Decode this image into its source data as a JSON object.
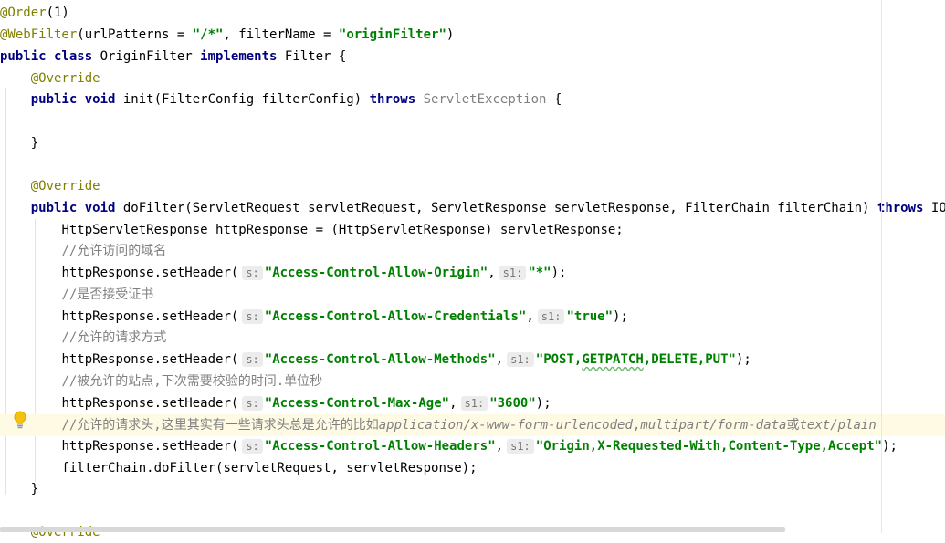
{
  "code": {
    "l0_annot": "@Order",
    "l0_rest": "(1)",
    "l1_annot": "@WebFilter",
    "l1_a": "(urlPatterns = ",
    "l1_s1": "\"/*\"",
    "l1_b": ", filterName = ",
    "l1_s2": "\"originFilter\"",
    "l1_c": ")",
    "l2_kw": "public class",
    "l2_a": " OriginFilter ",
    "l2_kw2": "implements",
    "l2_b": " Filter {",
    "l3_annot": "@Override",
    "l4_kw": "public void",
    "l4_a": " init(FilterConfig filterConfig) ",
    "l4_kw2": "throws",
    "l4_gray": " ServletException",
    "l4_b": " {",
    "l6": "}",
    "l8_annot": "@Override",
    "l9_kw": "public void",
    "l9_a": " doFilter(ServletRequest servletRequest, ServletResponse servletResponse, FilterChain filterChain) ",
    "l9_kw2": "throws",
    "l9_b": " IOException",
    "l10": "HttpServletResponse httpResponse = (HttpServletResponse) servletResponse;",
    "l11": "//允许访问的域名",
    "l12_a": "httpResponse.setHeader(",
    "l12_s1": "\"Access-Control-Allow-Origin\"",
    "l12_b": ",",
    "l12_s2": "\"*\"",
    "l12_c": ");",
    "l13": "//是否接受证书",
    "l14_a": "httpResponse.setHeader(",
    "l14_s1": "\"Access-Control-Allow-Credentials\"",
    "l14_b": ",",
    "l14_s2": "\"true\"",
    "l14_c": ");",
    "l15": "//允许的请求方式",
    "l16_a": "httpResponse.setHeader(",
    "l16_s1": "\"Access-Control-Allow-Methods\"",
    "l16_b": ",",
    "l16_s2a": "\"POST,",
    "l16_s2b": "GETPATCH",
    "l16_s2c": ",DELETE,PUT\"",
    "l16_c": ");",
    "l17": "//被允许的站点,下次需要校验的时间.单位秒",
    "l18_a": "httpResponse.setHeader(",
    "l18_s1": "\"Access-Control-Max-Age\"",
    "l18_b": ",",
    "l18_s2": "\"3600\"",
    "l18_c": ");",
    "l19_a": "//允许的请求头,这里其实有一些请求头总是允许的比如",
    "l19_b": "application/x-www-form-urlencoded",
    "l19_c": ",",
    "l19_d": "multipart/form-data",
    "l19_e": "或",
    "l19_f": "text/plain",
    "l20_a": "httpResponse.setHeader(",
    "l20_s1": "\"Access-Control-Allow-Headers\"",
    "l20_b": ",",
    "l20_s2": "\"Origin,X-Requested-With,Content-Type,Accept\"",
    "l20_c": ");",
    "l21": "filterChain.doFilter(servletRequest, servletResponse);",
    "l22": "}",
    "l24_annot": "@Override"
  },
  "hints": {
    "s": "s:",
    "s1": "s1:"
  },
  "colors": {
    "keyword": "#000080",
    "string": "#008000",
    "annotation": "#808000",
    "comment": "#808080",
    "current_line": "#fffae3"
  },
  "icons": {
    "intention": "lightbulb-icon"
  }
}
